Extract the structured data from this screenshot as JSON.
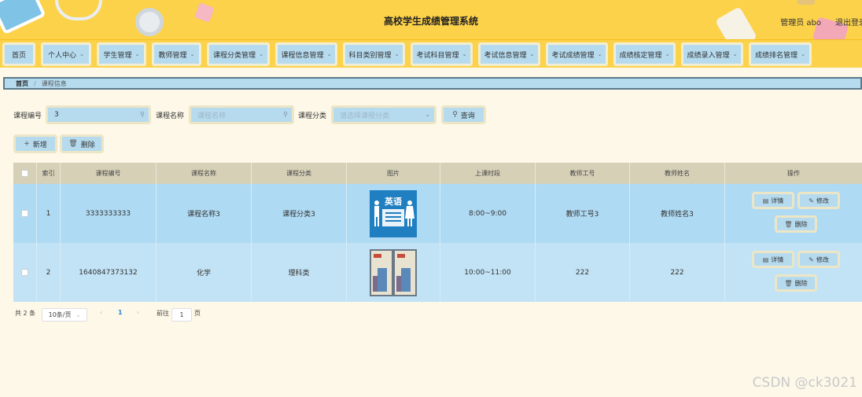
{
  "header": {
    "title": "高校学生成绩管理系统",
    "admin_label": "管理员 abo",
    "logout_label": "退出登录"
  },
  "nav": {
    "items": [
      {
        "label": "首页",
        "has_dropdown": false
      },
      {
        "label": "个人中心",
        "has_dropdown": true
      },
      {
        "label": "学生管理",
        "has_dropdown": true
      },
      {
        "label": "教师管理",
        "has_dropdown": true
      },
      {
        "label": "课程分类管理",
        "has_dropdown": true
      },
      {
        "label": "课程信息管理",
        "has_dropdown": true
      },
      {
        "label": "科目类别管理",
        "has_dropdown": true
      },
      {
        "label": "考试科目管理",
        "has_dropdown": true
      },
      {
        "label": "考试信息管理",
        "has_dropdown": true
      },
      {
        "label": "考试成绩管理",
        "has_dropdown": true
      },
      {
        "label": "成绩核定管理",
        "has_dropdown": true
      },
      {
        "label": "成绩录入管理",
        "has_dropdown": true
      },
      {
        "label": "成绩排名管理",
        "has_dropdown": true
      }
    ]
  },
  "breadcrumb": {
    "home": "首页",
    "separator": "/",
    "current": "课程信息"
  },
  "search": {
    "code_label": "课程编号",
    "code_value": "3",
    "name_label": "课程名称",
    "name_placeholder": "课程名称",
    "category_label": "课程分类",
    "category_placeholder": "请选择课程分类",
    "query_label": "查询"
  },
  "toolbar": {
    "add_label": "新增",
    "delete_label": "删除"
  },
  "table": {
    "columns": [
      "",
      "索引",
      "课程编号",
      "课程名称",
      "课程分类",
      "图片",
      "上课时段",
      "教师工号",
      "教师姓名",
      "操作"
    ],
    "rows": [
      {
        "index": "1",
        "code": "3333333333",
        "name": "课程名称3",
        "category": "课程分类3",
        "image": "english-corner-poster",
        "image_text": "英语",
        "time": "8:00~9:00",
        "teacher_id": "教师工号3",
        "teacher_name": "教师姓名3"
      },
      {
        "index": "2",
        "code": "1640847373132",
        "name": "化学",
        "category": "理科类",
        "image": "chemistry-book-covers",
        "image_text": "",
        "time": "10:00~11:00",
        "teacher_id": "222",
        "teacher_name": "222"
      }
    ],
    "actions": {
      "detail": "详情",
      "edit": "修改",
      "delete": "删除"
    }
  },
  "pagination": {
    "total": "共 2 条",
    "page_size": "10条/页",
    "current_page": "1",
    "goto_label": "前往",
    "goto_value": "1",
    "page_suffix": "页"
  },
  "watermark": "CSDN @ck3021",
  "colors": {
    "header_yellow": "#fcd24a",
    "light_blue": "#b6dbef",
    "row_blue": "#afdaf3",
    "table_head": "#d6d0b7",
    "background": "#fdf8e8"
  }
}
